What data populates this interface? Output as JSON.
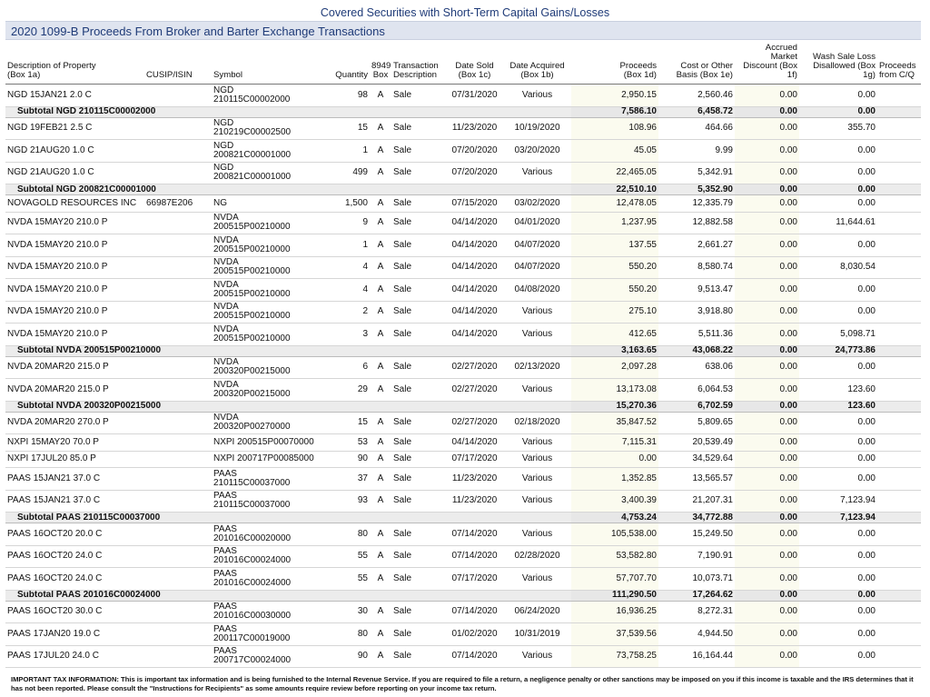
{
  "page_title": "Covered Securities with Short-Term Capital Gains/Losses",
  "section_title": "2020 1099-B Proceeds From Broker and Barter Exchange Transactions",
  "columns": {
    "description": "Description of Property\n(Box 1a)",
    "cusip": "CUSIP/ISIN",
    "symbol": "Symbol",
    "quantity": "Quantity",
    "box8949": "8949\nBox",
    "transaction": "Transaction\nDescription",
    "date_sold": "Date Sold\n(Box 1c)",
    "date_acquired": "Date Acquired\n(Box 1b)",
    "proceeds": "Proceeds\n(Box 1d)",
    "cost": "Cost or Other\nBasis (Box 1e)",
    "accrued": "Accrued Market\nDiscount (Box\n1f)",
    "wash": "Wash Sale Loss\nDisallowed (Box\n1g)",
    "proceeds_from": "Proceeds\nfrom C/Q"
  },
  "rows": [
    {
      "type": "tx",
      "desc": "NGD 15JAN21 2.0 C",
      "cusip": "",
      "symbol": "NGD\n210115C00002000",
      "qty": "98",
      "box": "A",
      "trans": "Sale",
      "sold": "07/31/2020",
      "acq": "Various",
      "proceeds": "2,950.15",
      "cost": "2,560.46",
      "accrued": "0.00",
      "wash": "0.00"
    },
    {
      "type": "sub",
      "desc": "Subtotal NGD  210115C00002000",
      "proceeds": "7,586.10",
      "cost": "6,458.72",
      "accrued": "0.00",
      "wash": "0.00"
    },
    {
      "type": "tx",
      "desc": "NGD 19FEB21 2.5 C",
      "cusip": "",
      "symbol": "NGD\n210219C00002500",
      "qty": "15",
      "box": "A",
      "trans": "Sale",
      "sold": "11/23/2020",
      "acq": "10/19/2020",
      "proceeds": "108.96",
      "cost": "464.66",
      "accrued": "0.00",
      "wash": "355.70"
    },
    {
      "type": "tx",
      "desc": "NGD 21AUG20 1.0 C",
      "cusip": "",
      "symbol": "NGD\n200821C00001000",
      "qty": "1",
      "box": "A",
      "trans": "Sale",
      "sold": "07/20/2020",
      "acq": "03/20/2020",
      "proceeds": "45.05",
      "cost": "9.99",
      "accrued": "0.00",
      "wash": "0.00"
    },
    {
      "type": "tx",
      "desc": "NGD 21AUG20 1.0 C",
      "cusip": "",
      "symbol": "NGD\n200821C00001000",
      "qty": "499",
      "box": "A",
      "trans": "Sale",
      "sold": "07/20/2020",
      "acq": "Various",
      "proceeds": "22,465.05",
      "cost": "5,342.91",
      "accrued": "0.00",
      "wash": "0.00"
    },
    {
      "type": "sub",
      "desc": "Subtotal NGD  200821C00001000",
      "proceeds": "22,510.10",
      "cost": "5,352.90",
      "accrued": "0.00",
      "wash": "0.00"
    },
    {
      "type": "tx",
      "desc": "NOVAGOLD RESOURCES INC",
      "cusip": "66987E206",
      "symbol": "NG",
      "qty": "1,500",
      "box": "A",
      "trans": "Sale",
      "sold": "07/15/2020",
      "acq": "03/02/2020",
      "proceeds": "12,478.05",
      "cost": "12,335.79",
      "accrued": "0.00",
      "wash": "0.00"
    },
    {
      "type": "tx",
      "desc": "NVDA 15MAY20 210.0 P",
      "cusip": "",
      "symbol": "NVDA\n200515P00210000",
      "qty": "9",
      "box": "A",
      "trans": "Sale",
      "sold": "04/14/2020",
      "acq": "04/01/2020",
      "proceeds": "1,237.95",
      "cost": "12,882.58",
      "accrued": "0.00",
      "wash": "11,644.61"
    },
    {
      "type": "tx",
      "desc": "NVDA 15MAY20 210.0 P",
      "cusip": "",
      "symbol": "NVDA\n200515P00210000",
      "qty": "1",
      "box": "A",
      "trans": "Sale",
      "sold": "04/14/2020",
      "acq": "04/07/2020",
      "proceeds": "137.55",
      "cost": "2,661.27",
      "accrued": "0.00",
      "wash": "0.00"
    },
    {
      "type": "tx",
      "desc": "NVDA 15MAY20 210.0 P",
      "cusip": "",
      "symbol": "NVDA\n200515P00210000",
      "qty": "4",
      "box": "A",
      "trans": "Sale",
      "sold": "04/14/2020",
      "acq": "04/07/2020",
      "proceeds": "550.20",
      "cost": "8,580.74",
      "accrued": "0.00",
      "wash": "8,030.54"
    },
    {
      "type": "tx",
      "desc": "NVDA 15MAY20 210.0 P",
      "cusip": "",
      "symbol": "NVDA\n200515P00210000",
      "qty": "4",
      "box": "A",
      "trans": "Sale",
      "sold": "04/14/2020",
      "acq": "04/08/2020",
      "proceeds": "550.20",
      "cost": "9,513.47",
      "accrued": "0.00",
      "wash": "0.00"
    },
    {
      "type": "tx",
      "desc": "NVDA 15MAY20 210.0 P",
      "cusip": "",
      "symbol": "NVDA\n200515P00210000",
      "qty": "2",
      "box": "A",
      "trans": "Sale",
      "sold": "04/14/2020",
      "acq": "Various",
      "proceeds": "275.10",
      "cost": "3,918.80",
      "accrued": "0.00",
      "wash": "0.00"
    },
    {
      "type": "tx",
      "desc": "NVDA 15MAY20 210.0 P",
      "cusip": "",
      "symbol": "NVDA\n200515P00210000",
      "qty": "3",
      "box": "A",
      "trans": "Sale",
      "sold": "04/14/2020",
      "acq": "Various",
      "proceeds": "412.65",
      "cost": "5,511.36",
      "accrued": "0.00",
      "wash": "5,098.71"
    },
    {
      "type": "sub",
      "desc": "Subtotal NVDA  200515P00210000",
      "proceeds": "3,163.65",
      "cost": "43,068.22",
      "accrued": "0.00",
      "wash": "24,773.86"
    },
    {
      "type": "tx",
      "desc": "NVDA 20MAR20 215.0 P",
      "cusip": "",
      "symbol": "NVDA\n200320P00215000",
      "qty": "6",
      "box": "A",
      "trans": "Sale",
      "sold": "02/27/2020",
      "acq": "02/13/2020",
      "proceeds": "2,097.28",
      "cost": "638.06",
      "accrued": "0.00",
      "wash": "0.00"
    },
    {
      "type": "tx",
      "desc": "NVDA 20MAR20 215.0 P",
      "cusip": "",
      "symbol": "NVDA\n200320P00215000",
      "qty": "29",
      "box": "A",
      "trans": "Sale",
      "sold": "02/27/2020",
      "acq": "Various",
      "proceeds": "13,173.08",
      "cost": "6,064.53",
      "accrued": "0.00",
      "wash": "123.60"
    },
    {
      "type": "sub",
      "desc": "Subtotal NVDA  200320P00215000",
      "proceeds": "15,270.36",
      "cost": "6,702.59",
      "accrued": "0.00",
      "wash": "123.60"
    },
    {
      "type": "tx",
      "desc": "NVDA 20MAR20 270.0 P",
      "cusip": "",
      "symbol": "NVDA\n200320P00270000",
      "qty": "15",
      "box": "A",
      "trans": "Sale",
      "sold": "02/27/2020",
      "acq": "02/18/2020",
      "proceeds": "35,847.52",
      "cost": "5,809.65",
      "accrued": "0.00",
      "wash": "0.00"
    },
    {
      "type": "tx",
      "desc": "NXPI 15MAY20 70.0 P",
      "cusip": "",
      "symbol": "NXPI  200515P00070000",
      "qty": "53",
      "box": "A",
      "trans": "Sale",
      "sold": "04/14/2020",
      "acq": "Various",
      "proceeds": "7,115.31",
      "cost": "20,539.49",
      "accrued": "0.00",
      "wash": "0.00"
    },
    {
      "type": "tx",
      "desc": "NXPI 17JUL20 85.0 P",
      "cusip": "",
      "symbol": "NXPI  200717P00085000",
      "qty": "90",
      "box": "A",
      "trans": "Sale",
      "sold": "07/17/2020",
      "acq": "Various",
      "proceeds": "0.00",
      "cost": "34,529.64",
      "accrued": "0.00",
      "wash": "0.00"
    },
    {
      "type": "tx",
      "desc": "PAAS 15JAN21 37.0 C",
      "cusip": "",
      "symbol": "PAAS\n210115C00037000",
      "qty": "37",
      "box": "A",
      "trans": "Sale",
      "sold": "11/23/2020",
      "acq": "Various",
      "proceeds": "1,352.85",
      "cost": "13,565.57",
      "accrued": "0.00",
      "wash": "0.00"
    },
    {
      "type": "tx",
      "desc": "PAAS 15JAN21 37.0 C",
      "cusip": "",
      "symbol": "PAAS\n210115C00037000",
      "qty": "93",
      "box": "A",
      "trans": "Sale",
      "sold": "11/23/2020",
      "acq": "Various",
      "proceeds": "3,400.39",
      "cost": "21,207.31",
      "accrued": "0.00",
      "wash": "7,123.94"
    },
    {
      "type": "sub",
      "desc": "Subtotal PAAS  210115C00037000",
      "proceeds": "4,753.24",
      "cost": "34,772.88",
      "accrued": "0.00",
      "wash": "7,123.94"
    },
    {
      "type": "tx",
      "desc": "PAAS 16OCT20 20.0 C",
      "cusip": "",
      "symbol": "PAAS\n201016C00020000",
      "qty": "80",
      "box": "A",
      "trans": "Sale",
      "sold": "07/14/2020",
      "acq": "Various",
      "proceeds": "105,538.00",
      "cost": "15,249.50",
      "accrued": "0.00",
      "wash": "0.00"
    },
    {
      "type": "tx",
      "desc": "PAAS 16OCT20 24.0 C",
      "cusip": "",
      "symbol": "PAAS\n201016C00024000",
      "qty": "55",
      "box": "A",
      "trans": "Sale",
      "sold": "07/14/2020",
      "acq": "02/28/2020",
      "proceeds": "53,582.80",
      "cost": "7,190.91",
      "accrued": "0.00",
      "wash": "0.00"
    },
    {
      "type": "tx",
      "desc": "PAAS 16OCT20 24.0 C",
      "cusip": "",
      "symbol": "PAAS\n201016C00024000",
      "qty": "55",
      "box": "A",
      "trans": "Sale",
      "sold": "07/17/2020",
      "acq": "Various",
      "proceeds": "57,707.70",
      "cost": "10,073.71",
      "accrued": "0.00",
      "wash": "0.00"
    },
    {
      "type": "sub",
      "desc": "Subtotal PAAS  201016C00024000",
      "proceeds": "111,290.50",
      "cost": "17,264.62",
      "accrued": "0.00",
      "wash": "0.00"
    },
    {
      "type": "tx",
      "desc": "PAAS 16OCT20 30.0 C",
      "cusip": "",
      "symbol": "PAAS\n201016C00030000",
      "qty": "30",
      "box": "A",
      "trans": "Sale",
      "sold": "07/14/2020",
      "acq": "06/24/2020",
      "proceeds": "16,936.25",
      "cost": "8,272.31",
      "accrued": "0.00",
      "wash": "0.00"
    },
    {
      "type": "tx",
      "desc": "PAAS 17JAN20 19.0 C",
      "cusip": "",
      "symbol": "PAAS\n200117C00019000",
      "qty": "80",
      "box": "A",
      "trans": "Sale",
      "sold": "01/02/2020",
      "acq": "10/31/2019",
      "proceeds": "37,539.56",
      "cost": "4,944.50",
      "accrued": "0.00",
      "wash": "0.00"
    },
    {
      "type": "tx",
      "desc": "PAAS 17JUL20 24.0 C",
      "cusip": "",
      "symbol": "PAAS\n200717C00024000",
      "qty": "90",
      "box": "A",
      "trans": "Sale",
      "sold": "07/14/2020",
      "acq": "Various",
      "proceeds": "73,758.25",
      "cost": "16,164.44",
      "accrued": "0.00",
      "wash": "0.00"
    }
  ],
  "footer": "IMPORTANT TAX INFORMATION: This is important tax information and is being furnished to the Internal Revenue Service.  If you are required to file a return, a negligence penalty or other sanctions may be imposed on you if this income is taxable and the IRS determines that it has not been reported.   Please consult the \"Instructions for Recipients\" as some amounts require review before reporting on your income tax return."
}
